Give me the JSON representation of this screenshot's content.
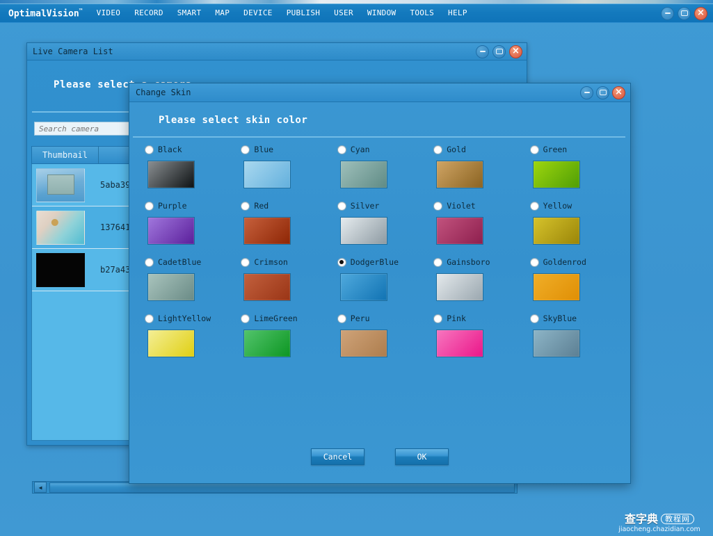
{
  "app": {
    "brand": "OptimalVision",
    "brand_tm": "™",
    "menu": [
      {
        "label": "VIDEO"
      },
      {
        "label": "RECORD"
      },
      {
        "label": "SMART"
      },
      {
        "label": "MAP"
      },
      {
        "label": "DEVICE"
      },
      {
        "label": "PUBLISH"
      },
      {
        "label": "USER"
      },
      {
        "label": "WINDOW"
      },
      {
        "label": "TOOLS"
      },
      {
        "label": "HELP"
      }
    ],
    "window_controls": {
      "minimize": "minimize-icon",
      "maximize": "maximize-icon",
      "close": "close-icon"
    }
  },
  "camera_list": {
    "title": "Live Camera List",
    "heading": "Please select a camera",
    "search": {
      "placeholder": "Search camera",
      "value": ""
    },
    "columns": [
      "Thumbnail",
      "",
      "",
      "",
      ""
    ],
    "rows": [
      {
        "id": "5aba390",
        "thumb": "desktop-screenshot"
      },
      {
        "id": "1376410",
        "thumb": "flower-photo"
      },
      {
        "id": "b27a430",
        "thumb": "black-frame"
      }
    ],
    "scrollbar": {
      "left_arrow": "◀"
    }
  },
  "skin_dialog": {
    "title": "Change Skin",
    "heading": "Please select skin color",
    "selected": "DodgerBlue",
    "colors": [
      {
        "label": "Black",
        "from": "#8a8f92",
        "to": "#0d1113"
      },
      {
        "label": "Blue",
        "from": "#a9d8ef",
        "to": "#63b0dd"
      },
      {
        "label": "Cyan",
        "from": "#9fc0bb",
        "to": "#5f8b85"
      },
      {
        "label": "Gold",
        "from": "#d0a565",
        "to": "#8a6321"
      },
      {
        "label": "Green",
        "from": "#9ed60e",
        "to": "#4f9e05"
      },
      {
        "label": "Purple",
        "from": "#a077dd",
        "to": "#5b1f9b"
      },
      {
        "label": "Red",
        "from": "#c6603c",
        "to": "#8e2605"
      },
      {
        "label": "Silver",
        "from": "#e6ecef",
        "to": "#8d9aa2"
      },
      {
        "label": "Violet",
        "from": "#c2537e",
        "to": "#8e1f4e"
      },
      {
        "label": "Yellow",
        "from": "#d6c32c",
        "to": "#9a8508"
      },
      {
        "label": "CadetBlue",
        "from": "#a9c4bd",
        "to": "#6a8b86"
      },
      {
        "label": "Crimson",
        "from": "#c2603d",
        "to": "#9a3516"
      },
      {
        "label": "DodgerBlue",
        "from": "#4fa9dd",
        "to": "#1173b3"
      },
      {
        "label": "Gainsboro",
        "from": "#e4e9ec",
        "to": "#9aa7af"
      },
      {
        "label": "Goldenrod",
        "from": "#f0ae28",
        "to": "#e08f05"
      },
      {
        "label": "LightYellow",
        "from": "#f4ef96",
        "to": "#e0cf12"
      },
      {
        "label": "LimeGreen",
        "from": "#52c46c",
        "to": "#0d9622"
      },
      {
        "label": "Peru",
        "from": "#cfa379",
        "to": "#ad7d4d"
      },
      {
        "label": "Pink",
        "from": "#f776bf",
        "to": "#ea1689"
      },
      {
        "label": "SkyBlue",
        "from": "#8db5c7",
        "to": "#5c7f93"
      }
    ],
    "buttons": {
      "cancel": "Cancel",
      "ok": "OK"
    }
  },
  "watermark": {
    "cn_name": "查字典",
    "cn_box": "教程网",
    "url": "jiaocheng.chazidian.com"
  }
}
